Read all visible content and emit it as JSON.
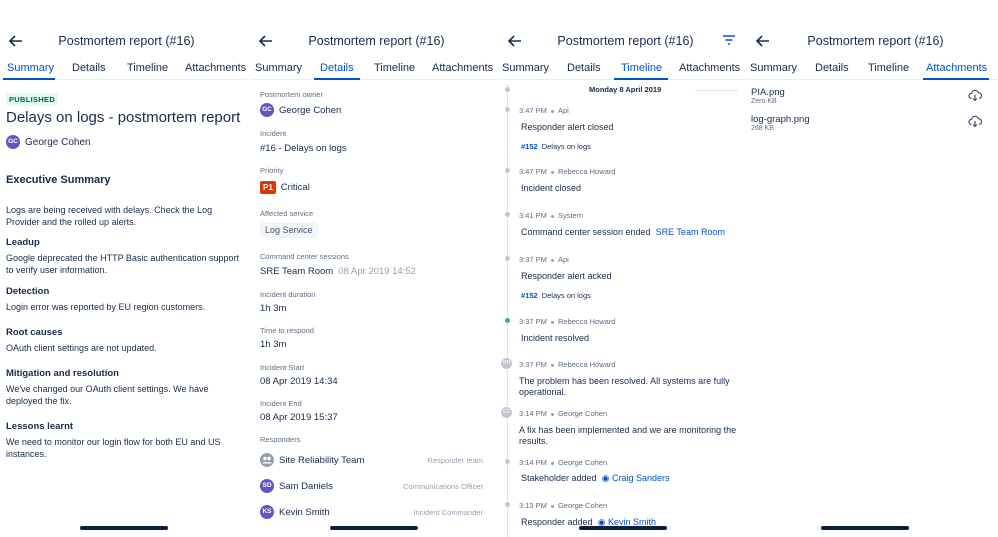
{
  "header": {
    "title": "Postmortem report (#16)"
  },
  "tabs": [
    "Summary",
    "Details",
    "Timeline",
    "Attachments"
  ],
  "summary": {
    "status": "PUBLISHED",
    "heading": "Delays on logs - postmortem report",
    "author": {
      "initials": "GC",
      "name": "George Cohen"
    },
    "exec_title": "Executive Summary",
    "exec_text": "Logs are being received with delays. Check the Log Provider and the rolled up alerts.",
    "sections": [
      {
        "title": "Leadup",
        "text": "Google deprecated the HTTP Basic authentication support to verify user information."
      },
      {
        "title": "Detection",
        "text": "Login error was reported by EU region customers."
      },
      {
        "title": "Root causes",
        "text": "OAuth client settings are not updated."
      },
      {
        "title": "Mitigation and resolution",
        "text": "We've changed our OAuth client settings. We have deployed the fix."
      },
      {
        "title": "Lessons learnt",
        "text": "We need to monitor our login flow for both EU and US instances."
      }
    ]
  },
  "details": {
    "owner_label": "Postmortem owner",
    "owner": {
      "initials": "GC",
      "name": "George Cohen"
    },
    "incident_label": "Incident",
    "incident": "#16 - Delays on logs",
    "priority_label": "Priority",
    "priority_badge": "P1",
    "priority": "Critical",
    "service_label": "Affected service",
    "service": "Log Service",
    "sessions_label": "Command center sessions",
    "session_name": "SRE Team Room",
    "session_time": "08 Apr 2019 14:52",
    "duration_label": "Incident duration",
    "duration": "1h 3m",
    "respond_label": "Time to respond",
    "respond": "1h 3m",
    "start_label": "Incident Start",
    "start": "08 Apr 2019 14:34",
    "end_label": "Incident End",
    "end": "08 Apr 2019 15:37",
    "responders_label": "Responders",
    "responders": [
      {
        "initials": "",
        "name": "Site Reliability Team",
        "role": "Responder team"
      },
      {
        "initials": "SD",
        "name": "Sam Daniels",
        "role": "Communications Officer"
      },
      {
        "initials": "KS",
        "name": "Kevin Smith",
        "role": "Incident Commander"
      }
    ]
  },
  "timeline": {
    "date": "Monday 8 April 2019",
    "events": [
      {
        "time": "3:47 PM",
        "actor": "Api",
        "text": "Responder alert closed",
        "tag_id": "#152",
        "tag_text": "Delays on logs"
      },
      {
        "time": "3:47 PM",
        "actor": "Rebecca Howard",
        "text": "Incident closed"
      },
      {
        "time": "3:41 PM",
        "actor": "System",
        "text": "Command center session ended",
        "link": "SRE Team Room"
      },
      {
        "time": "3:37 PM",
        "actor": "Api",
        "text": "Responder alert acked",
        "tag_id": "#152",
        "tag_text": "Delays on logs"
      },
      {
        "time": "3:37 PM",
        "actor": "Rebecca Howard",
        "text": "Incident resolved"
      },
      {
        "time": "3:37 PM",
        "actor": "Rebecca Howard",
        "initials": "RH",
        "text": "The problem has been resolved. All systems are fully operational."
      },
      {
        "time": "3:14 PM",
        "actor": "George Cohen",
        "initials": "GC",
        "text": "A fix has been implemented and we are monitoring the results."
      },
      {
        "time": "3:14 PM",
        "actor": "George Cohen",
        "text": "Stakeholder added",
        "person": "Craig Sanders"
      },
      {
        "time": "3:13 PM",
        "actor": "George Cohen",
        "text": "Responder added",
        "person": "Kevin Smith"
      }
    ]
  },
  "attachments": [
    {
      "name": "PIA.png",
      "size": "Zero KB"
    },
    {
      "name": "log-graph.png",
      "size": "268 KB"
    }
  ],
  "colors": {
    "accent": "#0052cc",
    "text": "#172b4d",
    "critical": "#de350b",
    "avatar": "#6554c0"
  }
}
